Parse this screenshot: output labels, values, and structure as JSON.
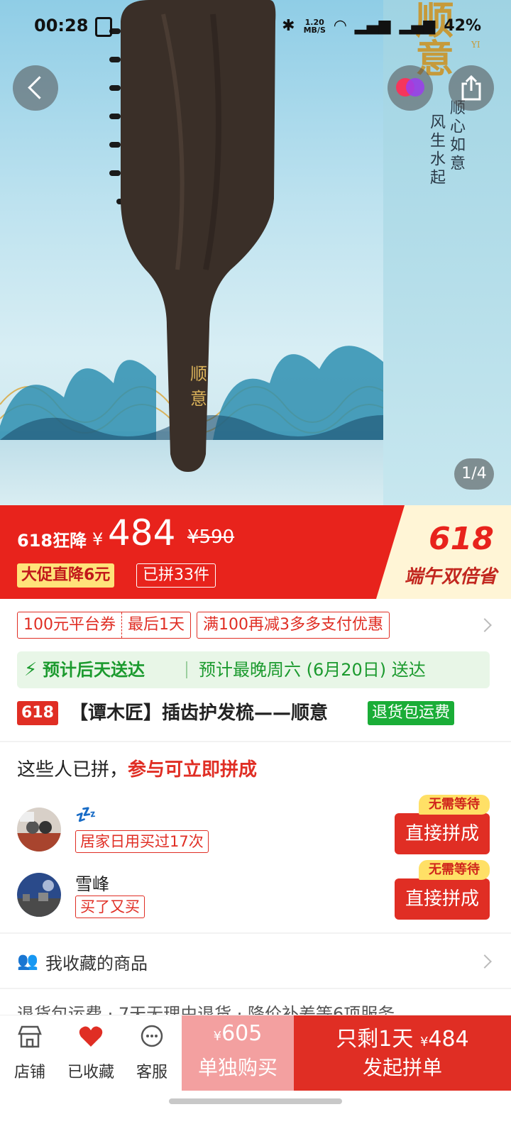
{
  "status_bar": {
    "time": "00:28",
    "net_speed_top": "1.20",
    "net_speed_bottom": "MB/S",
    "battery": "42%"
  },
  "hero": {
    "page_indicator": "1/4",
    "brush_text_1": "顺",
    "brush_text_2": "意",
    "side_title": "顺意",
    "side_pinyin": "YI",
    "slogan_1": "顺心如意",
    "slogan_2": "风生水起"
  },
  "price_banner": {
    "label": "618狂降",
    "yen": "¥",
    "price": "484",
    "original_price": "¥590",
    "tag_discount": "大促直降6元",
    "tag_count": "已拼33件",
    "promo_big": "618",
    "promo_sub": "端午双倍省"
  },
  "coupons": {
    "platform_left": "100元平台券",
    "platform_right": "最后1天",
    "pay_discount": "满100再减3多多支付优惠"
  },
  "delivery": {
    "fast": "预计后天送达",
    "latest": "预计最晚周六 (6月20日) 送达"
  },
  "product": {
    "badge": "618",
    "title": "【谭木匠】插齿护发梳——顺意",
    "return_tag": "退货包运费"
  },
  "group": {
    "heading_plain": "这些人已拼，",
    "heading_highlight": "参与可立即拼成",
    "buyers": [
      {
        "name": "💤",
        "tag": "居家日用买过17次",
        "badge": "无需等待",
        "button": "直接拼成"
      },
      {
        "name": "雪峰",
        "tag": "买了又买",
        "badge": "无需等待",
        "button": "直接拼成"
      }
    ]
  },
  "favorites": {
    "label": "我收藏的商品"
  },
  "services": {
    "text": "退货包运费 · 7天无理由退货 · 降价补差等6项服务"
  },
  "bottom_bar": {
    "store": "店铺",
    "favorited": "已收藏",
    "service": "客服",
    "alone_price_yen": "¥",
    "alone_price": "605",
    "alone_label": "单独购买",
    "group_prefix": "只剩1天",
    "group_price_yen": "¥",
    "group_price": "484",
    "group_label": "发起拼单"
  },
  "colors": {
    "brand_red": "#e02e24",
    "banner_red": "#e8231c",
    "green": "#1aad37",
    "alone_pink": "#f3a0a0"
  }
}
